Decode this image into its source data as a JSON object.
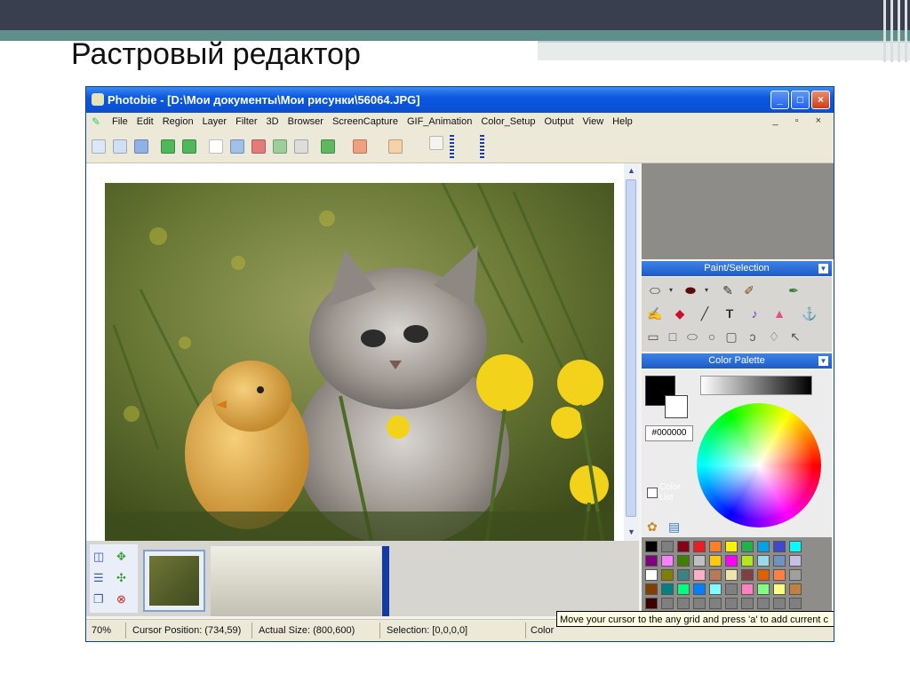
{
  "slide": {
    "title": "Растровый редактор"
  },
  "window": {
    "title": "Photobie - [D:\\Мои документы\\Мои рисунки\\56064.JPG]",
    "controls": {
      "minimize": "_",
      "maximize": "□",
      "close": "×"
    }
  },
  "menu": {
    "items": [
      "File",
      "Edit",
      "Region",
      "Layer",
      "Filter",
      "3D",
      "Browser",
      "ScreenCapture",
      "GIF_Animation",
      "Color_Setup",
      "Output",
      "View",
      "Help"
    ],
    "mdi_controls": "_ ▫ ×"
  },
  "paint_panel": {
    "title": "Paint/Selection",
    "tools_row1": [
      "ellipse-tool",
      "fill-ellipse-tool",
      "pencil-tool",
      "brush-tool",
      "airbrush-tool"
    ],
    "tools_row2": [
      "pen-tool",
      "eraser-tool",
      "line-tool",
      "text-tool",
      "clone-tool",
      "fill-tool",
      "anchor-tool"
    ],
    "tools_row3": [
      "rect-select",
      "square-select",
      "oval-select",
      "circle-select",
      "rounded-select",
      "lasso-select",
      "magic-select",
      "move-tool"
    ],
    "text_tool_label": "T"
  },
  "color_panel": {
    "title": "Color Palette",
    "hex": "#000000",
    "color_list_label": "Color List",
    "wheel_colors": [
      "#ff0000",
      "#ff00ff",
      "#0000ff",
      "#00ffff",
      "#00ff00",
      "#ffff00"
    ],
    "swatches": [
      "#000000",
      "#7f7f7f",
      "#880015",
      "#ed1c24",
      "#ff7f27",
      "#fff200",
      "#22b14c",
      "#00a2e8",
      "#3f48cc",
      "#00ffff",
      "#800080",
      "#ff80ff",
      "#408000",
      "#c0c0c0",
      "#ffc90e",
      "#ff00ff",
      "#b5e61d",
      "#99d9ea",
      "#7092be",
      "#c8bfe7",
      "#ffffff",
      "#808000",
      "#408080",
      "#ffaec9",
      "#b97a57",
      "#efe4b0",
      "#804040",
      "#e06000",
      "#ff8040",
      "#a0a0a0",
      "#804000",
      "#008080",
      "#00ff80",
      "#0080ff",
      "#80ffff",
      "#808080",
      "#ff80c0",
      "#80ff80",
      "#ffff80",
      "#c08040",
      "#400000",
      "#808080",
      "#808080",
      "#808080",
      "#808080",
      "#808080",
      "#808080",
      "#808080",
      "#808080",
      "#808080"
    ]
  },
  "status": {
    "zoom": "70%",
    "cursor": "Cursor Position: (734,59)",
    "actual_size": "Actual Size: (800,600)",
    "selection": "Selection: [0,0,0,0]",
    "color": "Color",
    "tooltip": "Move your cursor to the any grid and press 'a' to add current c"
  }
}
